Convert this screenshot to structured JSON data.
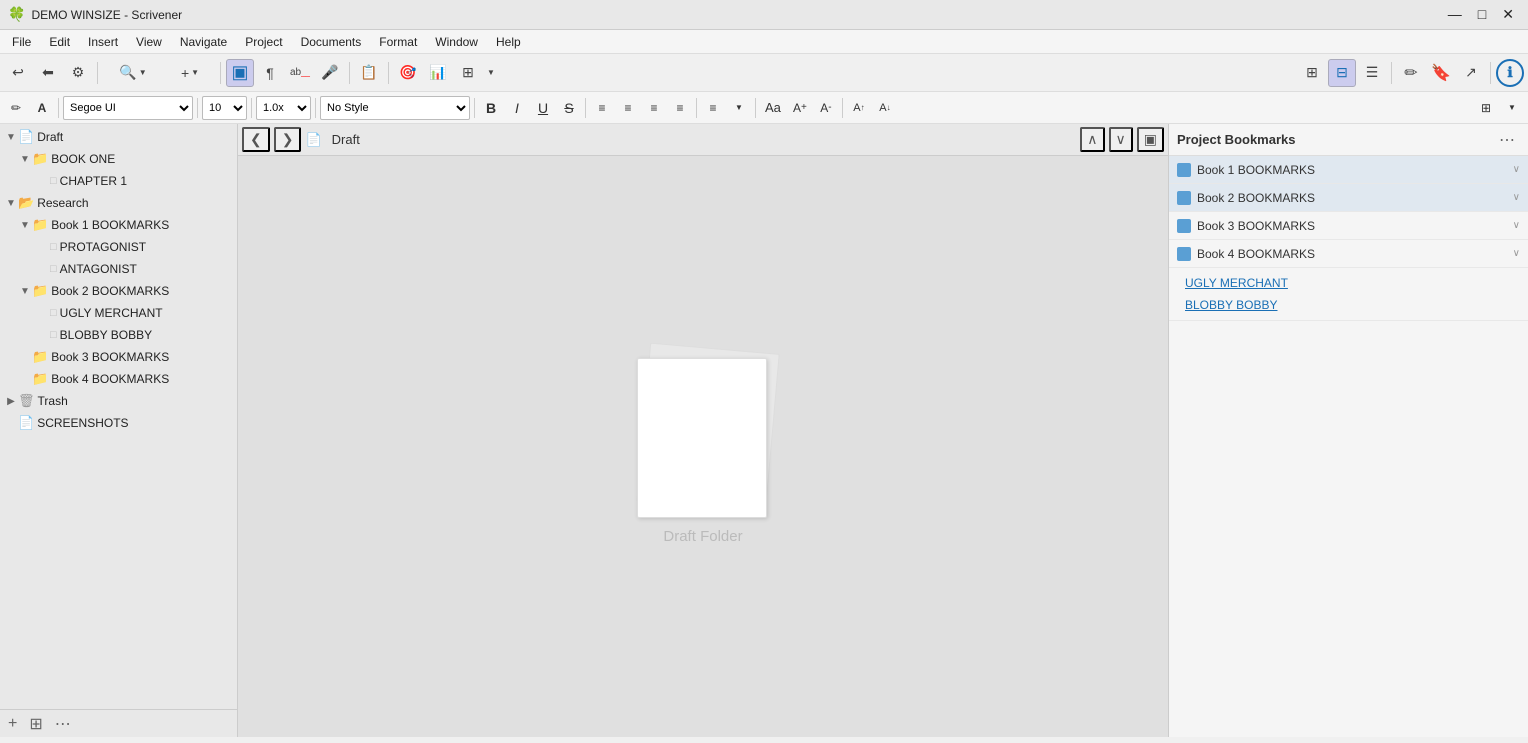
{
  "window": {
    "title": "DEMO WINSIZE - Scrivener",
    "icon": "🍀"
  },
  "title_bar_controls": {
    "minimize": "—",
    "maximize": "□",
    "close": "✕"
  },
  "menu": {
    "items": [
      "File",
      "Edit",
      "Insert",
      "View",
      "Navigate",
      "Project",
      "Documents",
      "Format",
      "Window",
      "Help"
    ]
  },
  "toolbar": {
    "buttons": [
      {
        "name": "undo-button",
        "icon": "↩",
        "label": "Undo"
      },
      {
        "name": "back-button",
        "icon": "⬅",
        "label": "Back"
      },
      {
        "name": "settings-button",
        "icon": "⚙",
        "label": "Settings"
      },
      {
        "name": "search-button",
        "icon": "🔍",
        "label": "Search"
      },
      {
        "name": "add-button",
        "icon": "+",
        "label": "Add"
      },
      {
        "name": "view1-button",
        "icon": "▣",
        "label": "View 1"
      },
      {
        "name": "paragraph-button",
        "icon": "¶",
        "label": "Paragraph"
      },
      {
        "name": "spell-button",
        "icon": "ab",
        "label": "Spell"
      },
      {
        "name": "dictate-button",
        "icon": "🎤",
        "label": "Dictate"
      },
      {
        "name": "copy-button",
        "icon": "📋",
        "label": "Copy"
      },
      {
        "name": "target-button",
        "icon": "🎯",
        "label": "Target"
      },
      {
        "name": "stats-button",
        "icon": "📊",
        "label": "Stats"
      },
      {
        "name": "grid-button",
        "icon": "⊞",
        "label": "Grid"
      }
    ],
    "right_buttons": [
      {
        "name": "tile-button",
        "icon": "⊞",
        "label": "Tile"
      },
      {
        "name": "outline-button",
        "icon": "⊟",
        "label": "Outline"
      },
      {
        "name": "list-button",
        "icon": "☰",
        "label": "List"
      },
      {
        "name": "compose-button",
        "icon": "✏",
        "label": "Compose"
      },
      {
        "name": "bookmark-button",
        "icon": "🔖",
        "label": "Bookmark"
      },
      {
        "name": "share-button",
        "icon": "↗",
        "label": "Share"
      },
      {
        "name": "help-button",
        "icon": "ℹ",
        "label": "Help"
      }
    ]
  },
  "format_toolbar": {
    "font": "Segoe UI",
    "size": "10",
    "spacing": "1.0x",
    "style": "No Style",
    "bold": "B",
    "italic": "I",
    "underline": "U",
    "strike": "S",
    "align_left": "≡",
    "align_center": "≡",
    "align_right": "≡",
    "align_justify": "≡",
    "list": "≡",
    "font_aa": "Aa",
    "font_bigger": "A+",
    "font_smaller": "A-",
    "super": "A",
    "sub": "A",
    "table_icon": "⊞"
  },
  "sidebar": {
    "items": [
      {
        "id": "draft",
        "label": "Draft",
        "level": 0,
        "type": "folder-white",
        "toggle": "▼",
        "expanded": true
      },
      {
        "id": "book-one",
        "label": "BOOK ONE",
        "level": 1,
        "type": "folder-blue",
        "toggle": "▼",
        "expanded": true
      },
      {
        "id": "chapter-1",
        "label": "CHAPTER 1",
        "level": 2,
        "type": "file",
        "toggle": "",
        "expanded": false
      },
      {
        "id": "research",
        "label": "Research",
        "level": 0,
        "type": "folder-yellow",
        "toggle": "▼",
        "expanded": true
      },
      {
        "id": "book1-bookmarks",
        "label": "Book 1 BOOKMARKS",
        "level": 1,
        "type": "folder-blue",
        "toggle": "▼",
        "expanded": true
      },
      {
        "id": "protagonist",
        "label": "PROTAGONIST",
        "level": 2,
        "type": "file",
        "toggle": "",
        "expanded": false
      },
      {
        "id": "antagonist",
        "label": "ANTAGONIST",
        "level": 2,
        "type": "file",
        "toggle": "",
        "expanded": false
      },
      {
        "id": "book2-bookmarks",
        "label": "Book 2 BOOKMARKS",
        "level": 1,
        "type": "folder-blue",
        "toggle": "▼",
        "expanded": true
      },
      {
        "id": "ugly-merchant",
        "label": "UGLY MERCHANT",
        "level": 2,
        "type": "file",
        "toggle": "",
        "expanded": false
      },
      {
        "id": "blobby-bobby",
        "label": "BLOBBY BOBBY",
        "level": 2,
        "type": "file",
        "toggle": "",
        "expanded": false
      },
      {
        "id": "book3-bookmarks",
        "label": "Book 3 BOOKMARKS",
        "level": 1,
        "type": "folder-blue",
        "toggle": "",
        "expanded": false
      },
      {
        "id": "book4-bookmarks",
        "label": "Book 4 BOOKMARKS",
        "level": 1,
        "type": "folder-blue",
        "toggle": "",
        "expanded": false
      },
      {
        "id": "trash",
        "label": "Trash",
        "level": 0,
        "type": "trash",
        "toggle": "▶",
        "expanded": false
      },
      {
        "id": "screenshots",
        "label": "SCREENSHOTS",
        "level": 0,
        "type": "folder-white",
        "toggle": "",
        "expanded": false
      }
    ],
    "footer_buttons": [
      "+",
      "⊞",
      "⋯"
    ]
  },
  "editor": {
    "nav_prev": "❮",
    "nav_next": "❯",
    "breadcrumb": "Draft",
    "up_btn": "∧",
    "down_btn": "∨",
    "split_btn": "▣",
    "draft_folder_label": "Draft Folder"
  },
  "right_panel": {
    "title": "Project Bookmarks",
    "menu_btn": "⋯",
    "bookmarks": [
      {
        "id": "book1-bm",
        "label": "Book 1 BOOKMARKS",
        "expanded": true,
        "color": "#5a9fd4"
      },
      {
        "id": "book2-bm",
        "label": "Book 2 BOOKMARKS",
        "expanded": true,
        "color": "#5a9fd4"
      },
      {
        "id": "book3-bm",
        "label": "Book 3 BOOKMARKS",
        "expanded": false,
        "color": "#5a9fd4"
      },
      {
        "id": "book4-bm",
        "label": "Book 4 BOOKMARKS",
        "expanded": false,
        "color": "#5a9fd4"
      }
    ],
    "sub_items": [
      {
        "label": "UGLY MERCHANT",
        "link": true
      },
      {
        "label": "BLOBBY BOBBY",
        "link": true
      }
    ],
    "chevron_expanded": "∨",
    "chevron_collapsed": "∨"
  },
  "colors": {
    "accent_blue": "#1a6fb5",
    "folder_blue": "#5a9fd4",
    "research_yellow": "#d4a520",
    "sidebar_bg": "#e8e8e8",
    "toolbar_bg": "#f0f0f0",
    "editor_bg": "#e0e0e0",
    "right_bg": "#f5f5f5"
  }
}
